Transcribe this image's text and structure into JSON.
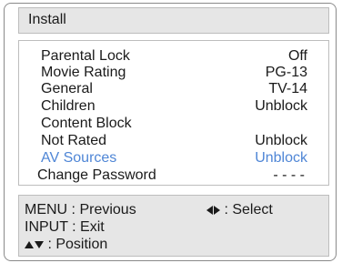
{
  "title": "Install",
  "menu": {
    "items": [
      {
        "label": "Parental Lock",
        "value": "Off"
      },
      {
        "label": "Movie Rating",
        "value": "PG-13"
      },
      {
        "label": "General",
        "value": "TV-14"
      },
      {
        "label": "Children",
        "value": "Unblock"
      },
      {
        "label": "Content Block",
        "value": ""
      },
      {
        "label": "Not Rated",
        "value": "Unblock"
      },
      {
        "label": "AV Sources",
        "value": "Unblock",
        "selected": true
      },
      {
        "label": "Change Password",
        "value": "- - - -"
      }
    ]
  },
  "help": {
    "menu_text": "MENU : Previous",
    "select_text": ": Select",
    "input_text": "INPUT : Exit",
    "position_text": ": Position",
    "select_icon": "left-right-arrows-icon",
    "position_icon": "up-down-arrows-icon"
  },
  "colors": {
    "selected": "#4f86d6",
    "panel": "#e6e6e6",
    "text": "#1a1a1a"
  }
}
